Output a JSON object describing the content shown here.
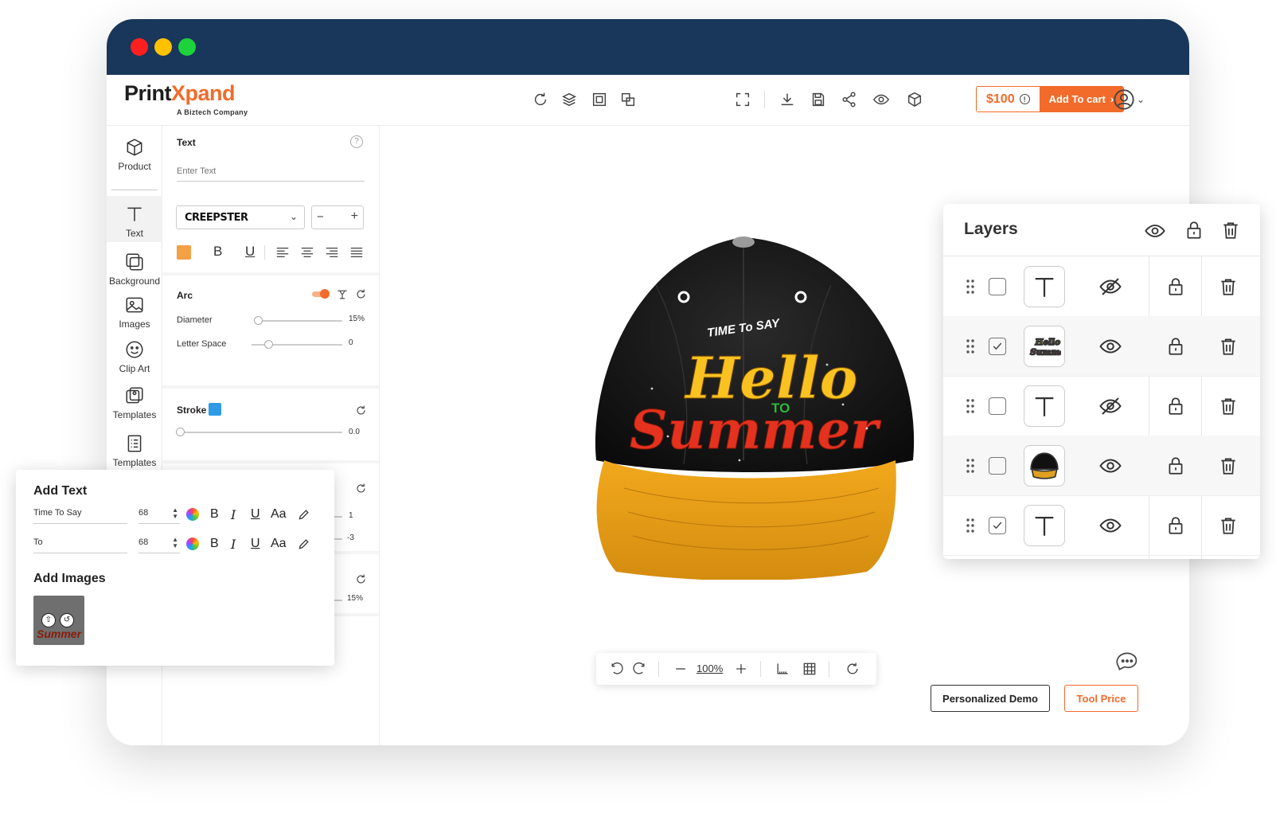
{
  "app": {
    "brand_part1": "Print",
    "brand_part2": "Xpand",
    "tagline": "A Biztech Company"
  },
  "colors": {
    "accent": "#f26b2a",
    "titlebar": "#18375a",
    "close": "#ff1f1f",
    "minimize": "#ffc200",
    "maximize": "#1ed23b",
    "text_color": "#f4a045",
    "stroke_color": "#2e9be6"
  },
  "toolbar": {
    "icons": [
      "refresh-icon",
      "layers-icon",
      "crop-icon",
      "duplicate-icon",
      "fullscreen-icon",
      "download-icon",
      "save-icon",
      "share-icon",
      "preview-icon",
      "3d-box-icon"
    ],
    "price": "$100",
    "add_to_cart": "Add To cart",
    "user_icon": "user-icon"
  },
  "nav": [
    {
      "label": "Product",
      "icon": "cube-icon"
    },
    {
      "label": "Text",
      "icon": "text-icon"
    },
    {
      "label": "Background",
      "icon": "background-icon"
    },
    {
      "label": "Images",
      "icon": "image-icon"
    },
    {
      "label": "Clip Art",
      "icon": "smiley-icon"
    },
    {
      "label": "Templates",
      "icon": "templates-icon"
    },
    {
      "label": "Templates",
      "icon": "checklist-icon"
    }
  ],
  "text_panel": {
    "title": "Text",
    "placeholder": "Enter Text",
    "font": "CREEPSTER",
    "arc_label": "Arc",
    "diameter_label": "Diameter",
    "diameter_value": "15%",
    "letter_space_label": "Letter Space",
    "letter_space_value": "0",
    "stroke_label": "Stroke",
    "stroke_value": "0.0",
    "hidden_value_1": "1",
    "hidden_value_2": "-3",
    "hidden_value_3": "15%",
    "diameter_pct": 0.02,
    "letter_space_pct": 0.18,
    "stroke_pct": 0.0
  },
  "canvas": {
    "design_line1": "TIME To SAY",
    "design_line2": "Hello",
    "design_line3": "TO",
    "design_line4": "Summer",
    "zoom": "100%"
  },
  "layers": {
    "title": "Layers",
    "rows": [
      {
        "thumb": "text",
        "checked": false,
        "visible": false
      },
      {
        "thumb": "design",
        "checked": true,
        "visible": true
      },
      {
        "thumb": "text",
        "checked": false,
        "visible": false
      },
      {
        "thumb": "cap",
        "checked": false,
        "visible": true
      },
      {
        "thumb": "text",
        "checked": true,
        "visible": true
      }
    ]
  },
  "add_text": {
    "title": "Add Text",
    "rows": [
      {
        "text": "Time To Say",
        "size": "68"
      },
      {
        "text": "To",
        "size": "68"
      }
    ],
    "images_title": "Add Images",
    "format_bold": "B",
    "format_italic": "I",
    "format_underline": "U",
    "format_case": "Aa"
  },
  "footer": {
    "demo": "Personalized Demo",
    "tool_price": "Tool Price"
  }
}
